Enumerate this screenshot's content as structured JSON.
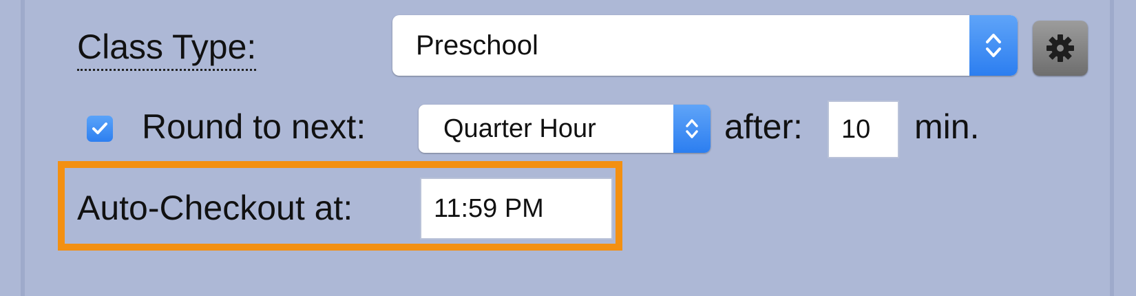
{
  "class_type": {
    "label": "Class Type:",
    "selected": "Preschool"
  },
  "rounding": {
    "checkbox_checked": true,
    "label": "Round to next:",
    "selected": "Quarter Hour",
    "after_label": "after:",
    "after_value": "10",
    "unit_label": "min."
  },
  "auto_checkout": {
    "label": "Auto-Checkout at:",
    "value": "11:59 PM"
  },
  "colors": {
    "panel_background": "#adb8d6",
    "accent_blue": "#2c7ef0",
    "highlight_orange": "#f39012"
  },
  "icons": {
    "gear": "gear-icon",
    "stepper": "up-down-chevron-icon",
    "check": "checkmark-icon"
  }
}
